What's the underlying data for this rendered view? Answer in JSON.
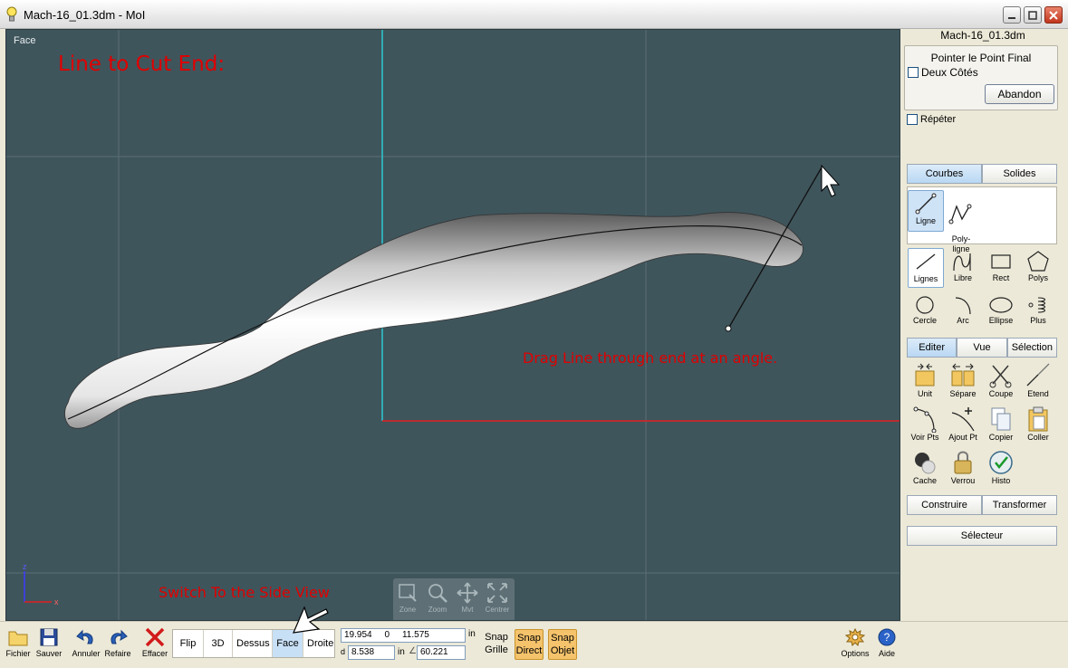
{
  "window": {
    "title": "Mach-16_01.3dm - MoI"
  },
  "viewport": {
    "view_label": "Face",
    "annotation_title": "Line to Cut End:",
    "annotation_drag": "Drag Line through end at an angle.",
    "annotation_switch": "Switch To the Side View",
    "axis_z": "z",
    "axis_x": "x",
    "nav": {
      "zone": "Zone",
      "zoom": "Zoom",
      "pan": "Mvt",
      "center": "Centrer"
    }
  },
  "panel": {
    "filename": "Mach-16_01.3dm",
    "prompt": "Pointer le Point Final",
    "both_sides": "Deux Côtés",
    "cancel": "Abandon",
    "repeat": "Répéter",
    "curve_tabs": [
      "Courbes",
      "Solides"
    ],
    "line_tools": [
      {
        "label": "Ligne",
        "icon": "line-icon"
      },
      {
        "label": "Poly-\nligne",
        "icon": "polyline-icon"
      }
    ],
    "curve_tools": [
      {
        "label": "Lignes",
        "icon": "lines-icon"
      },
      {
        "label": "Libre",
        "icon": "freehand-icon"
      },
      {
        "label": "Rect",
        "icon": "rectangle-icon"
      },
      {
        "label": "Polys",
        "icon": "polygon-icon"
      },
      {
        "label": "Cercle",
        "icon": "circle-icon"
      },
      {
        "label": "Arc",
        "icon": "arc-icon"
      },
      {
        "label": "Ellipse",
        "icon": "ellipse-icon"
      },
      {
        "label": "Plus",
        "icon": "more-icon"
      }
    ],
    "edit_tabs": [
      "Editer",
      "Vue",
      "Sélection"
    ],
    "edit_tools": [
      {
        "label": "Unit",
        "icon": "join-icon"
      },
      {
        "label": "Sépare",
        "icon": "separate-icon"
      },
      {
        "label": "Coupe",
        "icon": "trim-icon"
      },
      {
        "label": "Etend",
        "icon": "extend-icon"
      },
      {
        "label": "Voir Pts",
        "icon": "show-points-icon"
      },
      {
        "label": "Ajout Pt",
        "icon": "add-point-icon"
      },
      {
        "label": "Copier",
        "icon": "copy-icon"
      },
      {
        "label": "Coller",
        "icon": "paste-icon"
      },
      {
        "label": "Cache",
        "icon": "hide-icon"
      },
      {
        "label": "Verrou",
        "icon": "lock-icon"
      },
      {
        "label": "Histo",
        "icon": "history-icon"
      }
    ],
    "build_tabs": [
      "Construire",
      "Transformer"
    ],
    "selector": "Sélecteur"
  },
  "toolbar": {
    "file": "Fichier",
    "save": "Sauver",
    "undo": "Annuler",
    "redo": "Refaire",
    "delete": "Effacer",
    "views": [
      "Flip",
      "3D",
      "Dessus",
      "Face",
      "Droite"
    ],
    "active_view": "Face",
    "coord_x": "19.954",
    "coord_y": "0",
    "coord_z": "11.575",
    "coord_unit": "in",
    "distance_label": "d",
    "distance": "8.538",
    "distance_unit": "in",
    "angle": "60.221",
    "snap_grid": "Snap\nGrille",
    "snap_direct": "Snap\nDirect",
    "snap_object": "Snap\nObjet",
    "options": "Options",
    "help": "Aide"
  },
  "colors": {
    "viewport_bg": "#3f555c",
    "annotation_red": "#e00000",
    "axis_cyan": "#2ec8d2",
    "axis_red": "#e02020",
    "highlight": "#c8e0f6",
    "snap_on": "#f5c36b"
  }
}
